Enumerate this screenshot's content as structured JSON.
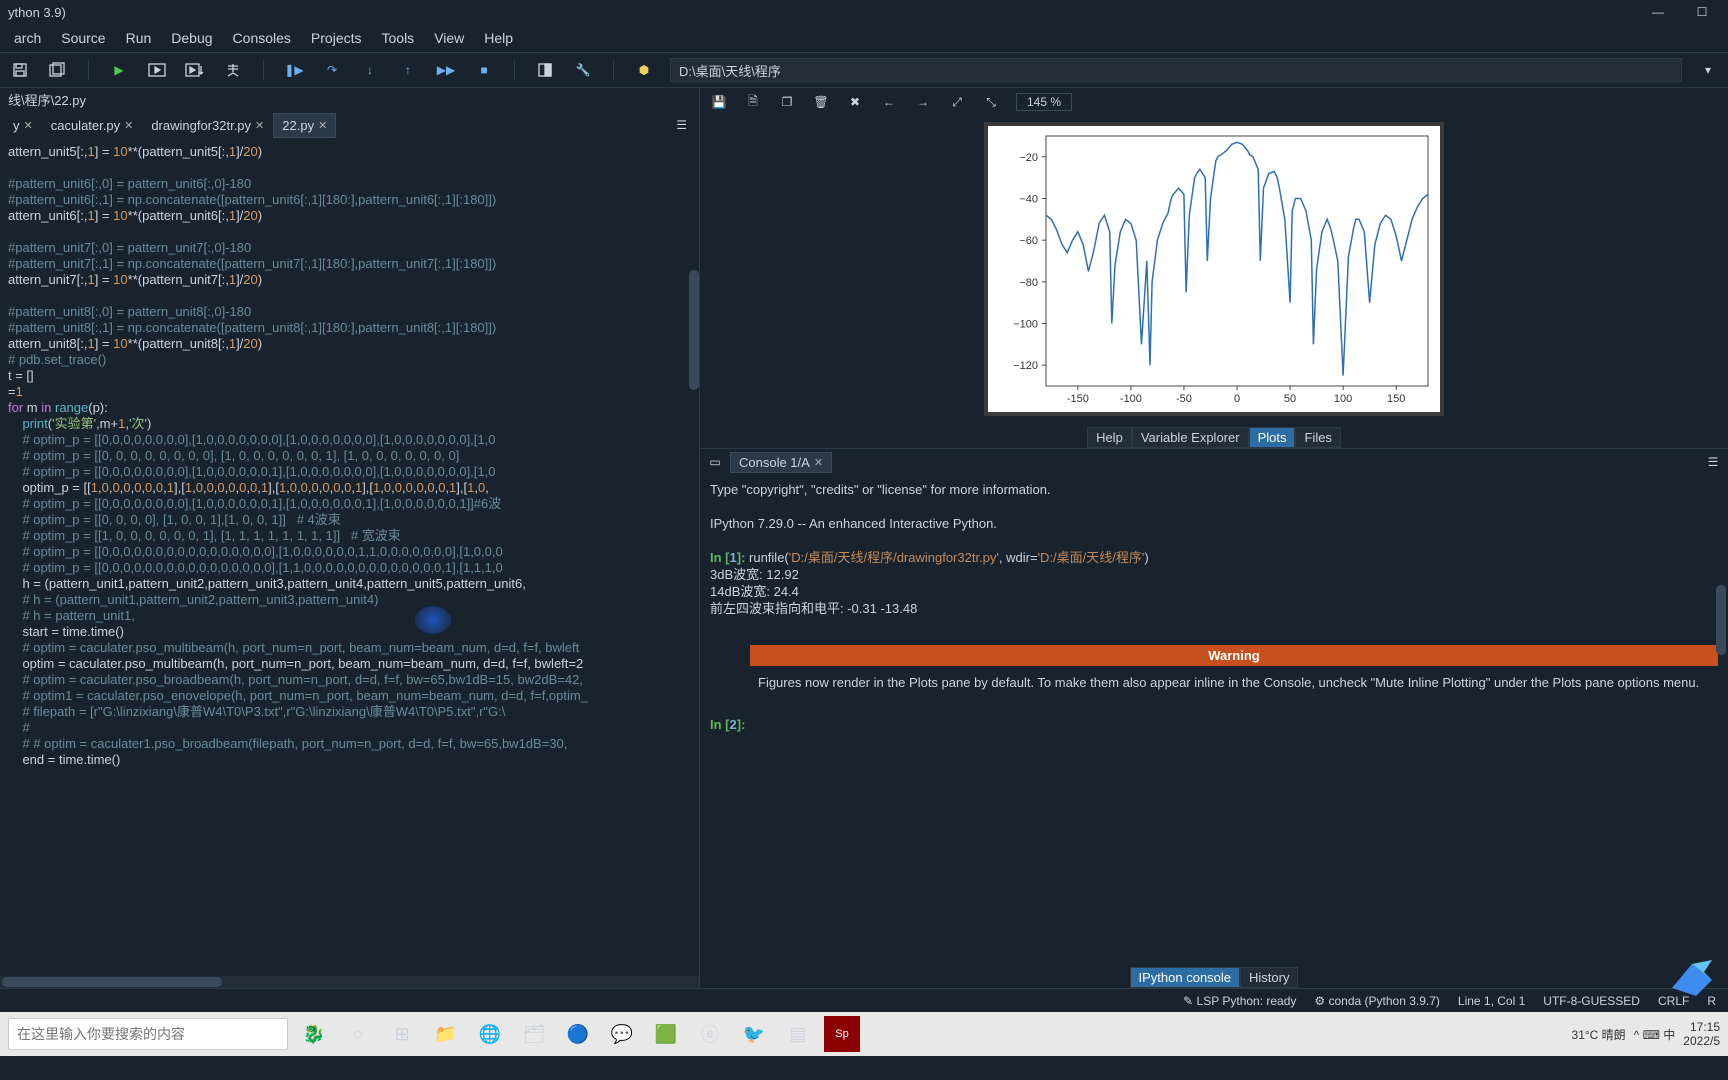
{
  "title": "ython 3.9)",
  "menu": [
    "arch",
    "Source",
    "Run",
    "Debug",
    "Consoles",
    "Projects",
    "Tools",
    "View",
    "Help"
  ],
  "path": "D:\\桌面\\天线\\程序",
  "breadcrumb": "线\\程序\\22.py",
  "tabs": {
    "items": [
      {
        "label": "y",
        "close": true
      },
      {
        "label": "caculater.py",
        "close": true
      },
      {
        "label": "drawingfor32tr.py",
        "close": true
      },
      {
        "label": "22.py",
        "close": true,
        "active": true
      }
    ]
  },
  "editor": {
    "lines": [
      {
        "t": "attern_unit5[:,1] = 10**(pattern_unit5[:,1]/20)",
        "c": "code"
      },
      {
        "t": "",
        "c": "blank"
      },
      {
        "t": "#pattern_unit6[:,0] = pattern_unit6[:,0]-180",
        "c": "cmt"
      },
      {
        "t": "#pattern_unit6[:,1] = np.concatenate([pattern_unit6[:,1][180:],pattern_unit6[:,1][:180]])",
        "c": "cmt"
      },
      {
        "t": "attern_unit6[:,1] = 10**(pattern_unit6[:,1]/20)",
        "c": "code"
      },
      {
        "t": "",
        "c": "blank"
      },
      {
        "t": "#pattern_unit7[:,0] = pattern_unit7[:,0]-180",
        "c": "cmt"
      },
      {
        "t": "#pattern_unit7[:,1] = np.concatenate([pattern_unit7[:,1][180:],pattern_unit7[:,1][:180]])",
        "c": "cmt"
      },
      {
        "t": "attern_unit7[:,1] = 10**(pattern_unit7[:,1]/20)",
        "c": "code"
      },
      {
        "t": "",
        "c": "blank"
      },
      {
        "t": "#pattern_unit8[:,0] = pattern_unit8[:,0]-180",
        "c": "cmt"
      },
      {
        "t": "#pattern_unit8[:,1] = np.concatenate([pattern_unit8[:,1][180:],pattern_unit8[:,1][:180]])",
        "c": "cmt"
      },
      {
        "t": "attern_unit8[:,1] = 10**(pattern_unit8[:,1]/20)",
        "c": "code"
      },
      {
        "t": "# pdb.set_trace()",
        "c": "cmt"
      },
      {
        "t": "t = []",
        "c": "code"
      },
      {
        "t": "=1",
        "c": "code"
      },
      {
        "t": "for m in range(p):",
        "c": "for"
      },
      {
        "t": "    print('实验第',m+1,'次')",
        "c": "print"
      },
      {
        "t": "    # optim_p = [[0,0,0,0,0,0,0,0],[1,0,0,0,0,0,0,0],[1,0,0,0,0,0,0,0],[1,0,0,0,0,0,0,0],[1,0",
        "c": "cmt"
      },
      {
        "t": "    # optim_p = [[0, 0, 0, 0, 0, 0, 0, 0], [1, 0, 0, 0, 0, 0, 0, 1], [1, 0, 0, 0, 0, 0, 0, 0]",
        "c": "cmt"
      },
      {
        "t": "    # optim_p = [[0,0,0,0,0,0,0,0],[1,0,0,0,0,0,0,1],[1,0,0,0,0,0,0,0],[1,0,0,0,0,0,0,0],[1,0",
        "c": "cmt"
      },
      {
        "t": "    optim_p = [[1,0,0,0,0,0,0,1],[1,0,0,0,0,0,0,1],[1,0,0,0,0,0,0,1],[1,0,0,0,0,0,0,1],[1,0,",
        "c": "code"
      },
      {
        "t": "    # optim_p = [[0,0,0,0,0,0,0,0],[1,0,0,0,0,0,0,1],[1,0,0,0,0,0,0,1],[1,0,0,0,0,0,0,1]]#6波",
        "c": "cmt"
      },
      {
        "t": "    # optim_p = [[0, 0, 0, 0], [1, 0, 0, 1],[1, 0, 0, 1]]   # 4波束",
        "c": "cmt"
      },
      {
        "t": "    # optim_p = [[1, 0, 0, 0, 0, 0, 0, 1], [1, 1, 1, 1, 1, 1, 1, 1]]   # 宽波束",
        "c": "cmt"
      },
      {
        "t": "    # optim_p = [[0,0,0,0,0,0,0,0,0,0,0,0,0,0,0,0],[1,0,0,0,0,0,0,1,1,0,0,0,0,0,0,0],[1,0,0,0",
        "c": "cmt"
      },
      {
        "t": "    # optim_p = [[0,0,0,0,0,0,0,0,0,0,0,0,0,0,0,0],[1,1,0,0,0,0,0,0,0,0,0,0,0,0,0,1],[1,1,1,0",
        "c": "cmt"
      },
      {
        "t": "    h = (pattern_unit1,pattern_unit2,pattern_unit3,pattern_unit4,pattern_unit5,pattern_unit6,",
        "c": "code"
      },
      {
        "t": "    # h = (pattern_unit1,pattern_unit2,pattern_unit3,pattern_unit4)",
        "c": "cmt"
      },
      {
        "t": "    # h = pattern_unit1,",
        "c": "cmt"
      },
      {
        "t": "    start = time.time()",
        "c": "code"
      },
      {
        "t": "    # optim = caculater.pso_multibeam(h, port_num=n_port, beam_num=beam_num, d=d, f=f, bwleft",
        "c": "cmt"
      },
      {
        "t": "    optim = caculater.pso_multibeam(h, port_num=n_port, beam_num=beam_num, d=d, f=f, bwleft=2",
        "c": "code"
      },
      {
        "t": "    # optim = caculater.pso_broadbeam(h, port_num=n_port, d=d, f=f, bw=65,bw1dB=15, bw2dB=42,",
        "c": "cmt"
      },
      {
        "t": "    # optim1 = caculater.pso_enovelope(h, port_num=n_port, beam_num=beam_num, d=d, f=f,optim_",
        "c": "cmt"
      },
      {
        "t": "    # filepath = [r\"G:\\linzixiang\\康普W4\\T0\\P3.txt\",r\"G:\\linzixiang\\康普W4\\T0\\P5.txt\",r\"G:\\",
        "c": "cmt"
      },
      {
        "t": "    #",
        "c": "cmt"
      },
      {
        "t": "    # # optim = caculater1.pso_broadbeam(filepath, port_num=n_port, d=d, f=f, bw=65,bw1dB=30,",
        "c": "cmt"
      },
      {
        "t": "    end = time.time()",
        "c": "code"
      }
    ]
  },
  "plot_toolbar": {
    "zoom": "145 %"
  },
  "chart_data": {
    "type": "line",
    "xlim": [
      -180,
      180
    ],
    "ylim": [
      -130,
      -10
    ],
    "xticks": [
      -150,
      -100,
      -50,
      0,
      50,
      100,
      150
    ],
    "yticks": [
      -20,
      -40,
      -60,
      -80,
      -100,
      -120
    ],
    "x": [
      -180,
      -175,
      -170,
      -165,
      -160,
      -155,
      -150,
      -145,
      -140,
      -135,
      -130,
      -125,
      -120,
      -118,
      -115,
      -110,
      -105,
      -100,
      -95,
      -90,
      -85,
      -82,
      -80,
      -75,
      -70,
      -65,
      -62,
      -60,
      -55,
      -50,
      -48,
      -45,
      -40,
      -38,
      -35,
      -30,
      -28,
      -25,
      -20,
      -18,
      -15,
      -10,
      -5,
      0,
      5,
      10,
      12,
      15,
      20,
      22,
      25,
      30,
      35,
      38,
      40,
      45,
      50,
      52,
      55,
      60,
      65,
      70,
      72,
      75,
      80,
      85,
      88,
      90,
      95,
      100,
      105,
      110,
      112,
      115,
      120,
      125,
      130,
      135,
      140,
      145,
      150,
      155,
      160,
      165,
      170,
      175,
      180
    ],
    "y": [
      -48,
      -50,
      -55,
      -62,
      -66,
      -60,
      -56,
      -62,
      -75,
      -65,
      -52,
      -48,
      -56,
      -100,
      -72,
      -56,
      -50,
      -52,
      -60,
      -110,
      -70,
      -120,
      -80,
      -60,
      -52,
      -47,
      -40,
      -38,
      -35,
      -38,
      -85,
      -48,
      -30,
      -28,
      -26,
      -30,
      -70,
      -40,
      -22,
      -20,
      -19,
      -17,
      -14,
      -13,
      -14,
      -17,
      -19,
      -20,
      -26,
      -70,
      -35,
      -28,
      -27,
      -30,
      -35,
      -50,
      -90,
      -46,
      -40,
      -40,
      -46,
      -60,
      -110,
      -74,
      -56,
      -50,
      -54,
      -58,
      -70,
      -125,
      -68,
      -54,
      -50,
      -50,
      -56,
      -90,
      -62,
      -52,
      -48,
      -50,
      -58,
      -70,
      -60,
      -50,
      -44,
      -40,
      -38
    ]
  },
  "pane_tabs": [
    "Help",
    "Variable Explorer",
    "Plots",
    "Files"
  ],
  "pane_active": 2,
  "console": {
    "tab_label": "Console 1/A",
    "body_lines": [
      {
        "t": "Type \"copyright\", \"credits\" or \"license\" for more information.",
        "c": "plain"
      },
      {
        "t": "",
        "c": "blank"
      },
      {
        "t": "IPython 7.29.0 -- An enhanced Interactive Python.",
        "c": "plain"
      },
      {
        "t": "",
        "c": "blank"
      }
    ],
    "in1_prefix": "In [",
    "in1_num": "1",
    "in1_suffix": "]: ",
    "in1_cmd": "runfile(",
    "in1_arg1": "'D:/桌面/天线/程序/drawingfor32tr.py'",
    "in1_mid": ", wdir=",
    "in1_arg2": "'D:/桌面/天线/程序'",
    "in1_end": ")",
    "out_lines": [
      "3dB波宽:   12.92",
      "14dB波宽:   24.4",
      "前左四波束指向和电平:   -0.31 -13.48"
    ],
    "warning_title": "Warning",
    "warning_body": "Figures now render in the Plots pane by default. To make them also appear inline in the Console, uncheck \"Mute Inline Plotting\" under the Plots pane options menu.",
    "in2_prefix": "In [",
    "in2_num": "2",
    "in2_suffix": "]: "
  },
  "console_bot_tabs": [
    "IPython console",
    "History"
  ],
  "console_bot_active": 0,
  "status": {
    "lsp": "✎  LSP Python: ready",
    "conda": "⚙  conda (Python 3.9.7)",
    "pos": "Line 1, Col 1",
    "enc": "UTF-8-GUESSED",
    "eol": "CRLF",
    "rw": "R"
  },
  "taskbar": {
    "search_placeholder": "在这里输入你要搜索的内容",
    "weather": "31°C 晴朗",
    "ime": "^  ⌨  中",
    "time": "17:15",
    "date": "2022/5"
  }
}
